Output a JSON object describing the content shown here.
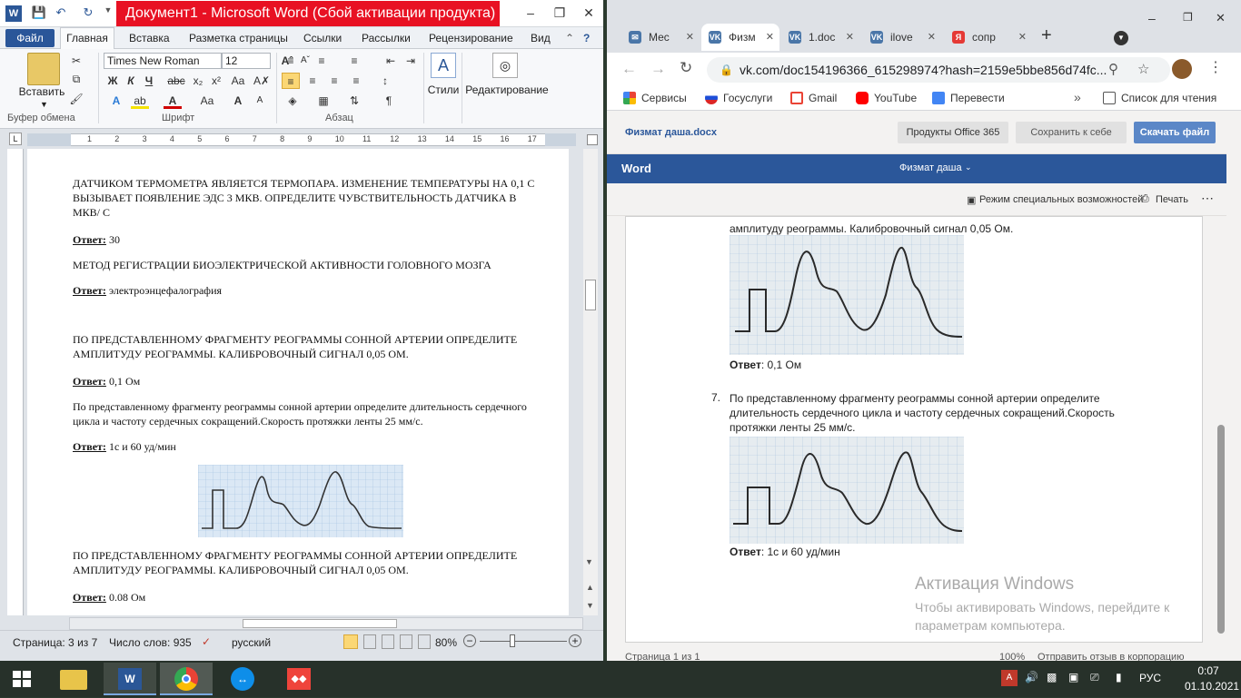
{
  "word": {
    "title": "Документ1 - Microsoft Word (Сбой активации продукта)",
    "tabs": [
      "Файл",
      "Главная",
      "Вставка",
      "Разметка страницы",
      "Ссылки",
      "Рассылки",
      "Рецензирование",
      "Вид"
    ],
    "ribbon": {
      "paste": "Вставить",
      "font_name": "Times New Roman",
      "font_size": "12",
      "styles": "Стили",
      "editing": "Редактирование",
      "groups": {
        "clipboard": "Буфер обмена",
        "font": "Шрифт",
        "paragraph": "Абзац"
      },
      "bold": "Ж",
      "italic": "К",
      "underline": "Ч"
    },
    "ruler_numbers": [
      "1",
      "2",
      "3",
      "4",
      "5",
      "6",
      "7",
      "8",
      "9",
      "10",
      "11",
      "12",
      "13",
      "14",
      "15",
      "16",
      "17"
    ],
    "doc": {
      "p1": "ДАТЧИКОМ ТЕРМОМЕТРА ЯВЛЯЕТСЯ ТЕРМОПАРА. ИЗМЕНЕНИЕ ТЕМПЕРАТУРЫ НА 0,1 С ВЫЗЫВАЕТ ПОЯВЛЕНИЕ ЭДС 3 МКВ. ОПРЕДЕЛИТЕ ЧУВСТВИТЕЛЬНОСТЬ ДАТЧИКА В МКВ/ С",
      "answer_label": "Ответ:",
      "a1": " 30",
      "p2": "МЕТОД РЕГИСТРАЦИИ БИОЭЛЕКТРИЧЕСКОЙ АКТИВНОСТИ ГОЛОВНОГО МОЗГА",
      "a2": " электроэнцефалография",
      "p3": "ПО ПРЕДСТАВЛЕННОМУ ФРАГМЕНТУ РЕОГРАММЫ СОННОЙ АРТЕРИИ ОПРЕДЕЛИТЕ АМПЛИТУДУ РЕОГРАММЫ. КАЛИБРОВОЧНЫЙ СИГНАЛ 0,05 ОМ.",
      "a3": " 0,1 Ом",
      "p4": "По представленному фрагменту реограммы сонной артерии определите длительность сердечного цикла и частоту сердечных сокращений.Скорость протяжки ленты 25 мм/с.",
      "a4": " 1с и 60 уд/мин",
      "p5": "ПО ПРЕДСТАВЛЕННОМУ ФРАГМЕНТУ РЕОГРАММЫ СОННОЙ АРТЕРИИ ОПРЕДЕЛИТЕ АМПЛИТУДУ РЕОГРАММЫ. КАЛИБРОВОЧНЫЙ СИГНАЛ 0,05 ОМ.",
      "a5": " 0.08 Ом"
    },
    "status": {
      "page": "Страница: 3 из 7",
      "words": "Число слов: 935",
      "lang": "русский",
      "zoom": "80%"
    }
  },
  "chrome": {
    "tabs": [
      {
        "label": "Мес",
        "color": "#4a76a8"
      },
      {
        "label": "Физм",
        "color": "#4a76a8"
      },
      {
        "label": "1.doc",
        "color": "#4a76a8"
      },
      {
        "label": "ilove",
        "color": "#4a76a8"
      },
      {
        "label": "сопр",
        "color": "#e53935"
      }
    ],
    "url": "vk.com/doc154196366_615298974?hash=2159e5bbe856d74fc...",
    "bookmarks": [
      "Сервисы",
      "Госуслуги",
      "Gmail",
      "YouTube",
      "Перевести"
    ],
    "reading_list": "Список для чтения"
  },
  "office_online": {
    "filename": "Физмат даша.docx",
    "products": "Продукты Office 365",
    "save": "Сохранить к себе",
    "download": "Скачать файл",
    "brand": "Word",
    "doc_title": "Физмат даша",
    "accessibility": "Режим специальных возможностей",
    "print": "Печать",
    "cut_line": "амплитуду реограммы. Калибровочный сигнал 0,05 Ом.",
    "answer_label": "Ответ",
    "answer1": ": 0,1 Ом",
    "item_number": "7.",
    "item_text": "По представленному фрагменту реограммы сонной артерии определите длительность сердечного цикла и частоту сердечных сокращений.Скорость протяжки ленты 25 мм/с.",
    "answer2": ": 1с и 60 уд/мин",
    "activation_title": "Активация Windows",
    "activation_text": "Чтобы активировать Windows, перейдите к параметрам компьютера.",
    "status_page": "Страница 1 из 1",
    "status_zoom": "100%",
    "status_feedback": "Отправить отзыв в корпорацию Майкрософт"
  },
  "taskbar": {
    "lang": "РУС",
    "time": "0:07",
    "date": "01.10.2021"
  }
}
